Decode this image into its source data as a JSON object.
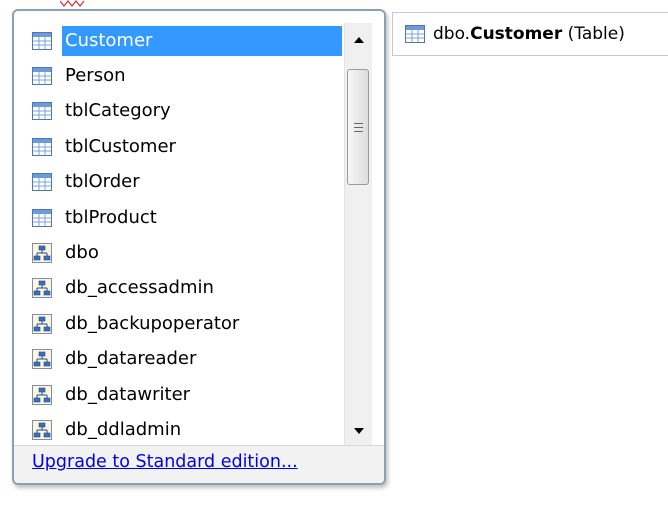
{
  "autocomplete": {
    "items": [
      {
        "label": "Customer",
        "icon": "table-icon",
        "selected": true
      },
      {
        "label": "Person",
        "icon": "table-icon"
      },
      {
        "label": "tblCategory",
        "icon": "table-icon"
      },
      {
        "label": "tblCustomer",
        "icon": "table-icon"
      },
      {
        "label": "tblOrder",
        "icon": "table-icon"
      },
      {
        "label": "tblProduct",
        "icon": "table-icon"
      },
      {
        "label": "dbo",
        "icon": "schema-icon"
      },
      {
        "label": "db_accessadmin",
        "icon": "schema-icon"
      },
      {
        "label": "db_backupoperator",
        "icon": "schema-icon"
      },
      {
        "label": "db_datareader",
        "icon": "schema-icon"
      },
      {
        "label": "db_datawriter",
        "icon": "schema-icon"
      },
      {
        "label": "db_ddladmin",
        "icon": "schema-icon"
      }
    ],
    "upgrade_link": "Upgrade to Standard edition..."
  },
  "tooltip": {
    "prefix": "dbo.",
    "name": "Customer",
    "suffix": " (Table)",
    "icon": "table-icon"
  },
  "colors": {
    "selection": "#3399ff",
    "link": "#0000ee",
    "popup_border": "#8a9fb8"
  }
}
